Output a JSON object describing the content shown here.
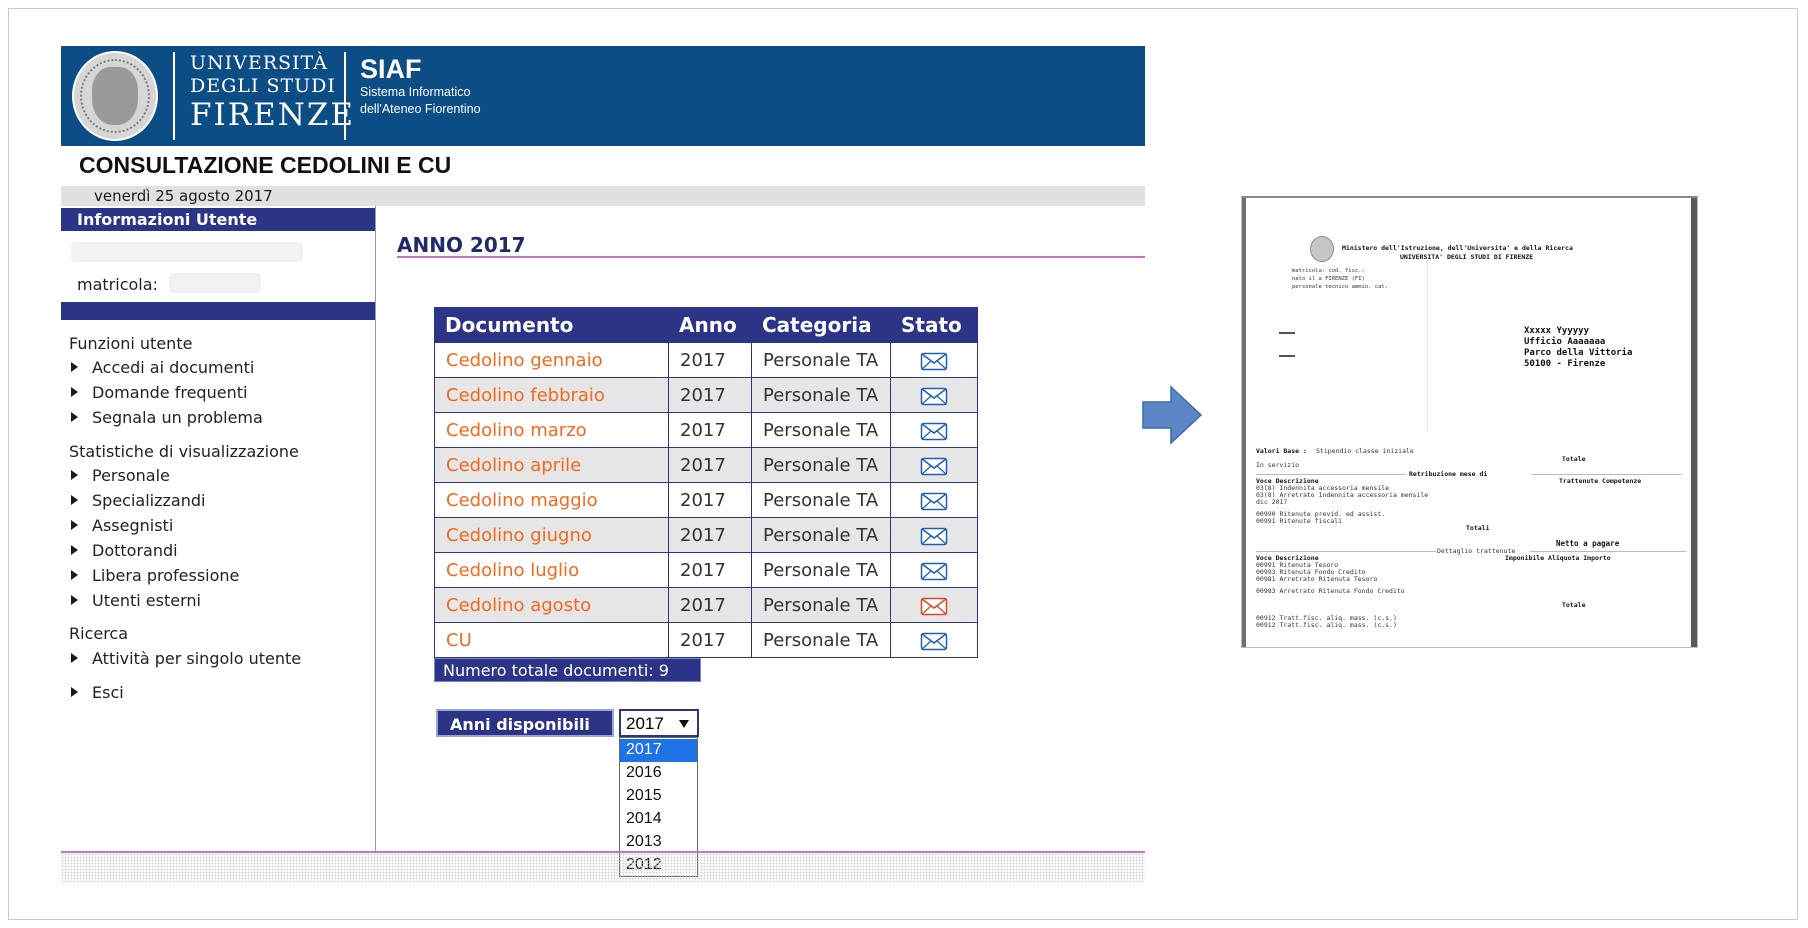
{
  "header": {
    "university_lines": [
      "UNIVERSITÀ",
      "DEGLI STUDI",
      "FIRENZE"
    ],
    "siaf_title": "SIAF",
    "siaf_sub_lines": [
      "Sistema Informatico",
      "dell'Ateneo Fiorentino"
    ],
    "app_title": "CONSULTAZIONE CEDOLINI E CU",
    "date": "venerdì 25 agosto 2017"
  },
  "sidebar": {
    "user_header": "Informazioni Utente",
    "matricola_label": "matricola:",
    "sections": [
      {
        "title": "Funzioni utente",
        "items": [
          "Accedi ai documenti",
          "Domande frequenti",
          "Segnala un problema"
        ]
      },
      {
        "title": "Statistiche di visualizzazione",
        "items": [
          "Personale",
          "Specializzandi",
          "Assegnisti",
          "Dottorandi",
          "Libera professione",
          "Utenti esterni"
        ]
      },
      {
        "title": "Ricerca",
        "items": [
          "Attività per singolo utente"
        ]
      }
    ],
    "exit_label": "Esci"
  },
  "main": {
    "year_heading": "ANNO 2017",
    "table": {
      "headers": [
        "Documento",
        "Anno",
        "Categoria",
        "Stato"
      ],
      "rows": [
        {
          "documento": "Cedolino gennaio",
          "anno": "2017",
          "categoria": "Personale TA",
          "stato": "read"
        },
        {
          "documento": "Cedolino febbraio",
          "anno": "2017",
          "categoria": "Personale TA",
          "stato": "read"
        },
        {
          "documento": "Cedolino marzo",
          "anno": "2017",
          "categoria": "Personale TA",
          "stato": "read"
        },
        {
          "documento": "Cedolino aprile",
          "anno": "2017",
          "categoria": "Personale TA",
          "stato": "read"
        },
        {
          "documento": "Cedolino maggio",
          "anno": "2017",
          "categoria": "Personale TA",
          "stato": "read"
        },
        {
          "documento": "Cedolino giugno",
          "anno": "2017",
          "categoria": "Personale TA",
          "stato": "read"
        },
        {
          "documento": "Cedolino luglio",
          "anno": "2017",
          "categoria": "Personale TA",
          "stato": "read"
        },
        {
          "documento": "Cedolino agosto",
          "anno": "2017",
          "categoria": "Personale TA",
          "stato": "unread"
        },
        {
          "documento": "CU",
          "anno": "2017",
          "categoria": "Personale TA",
          "stato": "read"
        }
      ]
    },
    "total_label": "Numero totale documenti: 9",
    "years_label": "Anni disponibili",
    "year_select": {
      "value": "2017",
      "options": [
        "2017",
        "2016",
        "2015",
        "2014",
        "2013",
        "2012"
      ]
    }
  },
  "preview": {
    "ministry_line": "Ministero dell'Istruzione, dell'Universita' e della Ricerca",
    "university_line": "UNIVERSITA' DEGLI STUDI DI FIRENZE",
    "small_lines": [
      "matricola:        cod. fisc.:",
      "nato il           a FIRENZE (FI)",
      "personale tecnico ammin. cat."
    ],
    "address_lines": [
      "Xxxxx Yyyyyy",
      "Ufficio Aaaaaaa",
      "Parco della Vittoria",
      "50100 - Firenze"
    ],
    "valori_base_label": "Valori Base :",
    "valori_base_text": "Stipendio classe iniziale",
    "totale_label": "Totale",
    "in_servizio": "In servizio",
    "retribuzione_label": "Retribuzione mese di",
    "voce_header": "Voce  Descrizione",
    "trattenute_competenze": "Trattenute  Competenze",
    "lines_a": [
      "03(8)  Indennita accessoria mensile",
      "03(8)  Arretrato Indennita accessoria mensile",
      "       dic 2017"
    ],
    "lines_b": [
      "00990  Ritenute previd. ed assist.",
      "00991  Ritenute fiscali"
    ],
    "totali_label": "Totali",
    "netto_label": "Netto a pagare",
    "dettaglio_label": "Dettaglio trattenute",
    "detail_header_left": "Voce  Descrizione",
    "detail_header_right": "Imponibile    Aliquota     Importo",
    "lines_c": [
      "00991  Ritenuta Tesoro",
      "00993  Ritenuta Fondo Credito",
      "00981  Arretrato Ritenuta Tesoro"
    ],
    "lines_d": [
      "00983  Arretrato Ritenuta Fondo Credito"
    ],
    "lines_e": [
      "00912  Tratt.fisc. aliq. mass. (c.s.)",
      "00912  Tratt.fisc. aliq. mass. (c.s.)"
    ]
  },
  "colors": {
    "header_blue": "#0d4d86",
    "nav_blue": "#2b3486",
    "link_orange": "#f06a1f",
    "accent_pink": "#c873c9",
    "envelope_read": "#1e5fb4",
    "envelope_unread": "#e0462b",
    "arrow_blue": "#5b87c7"
  }
}
